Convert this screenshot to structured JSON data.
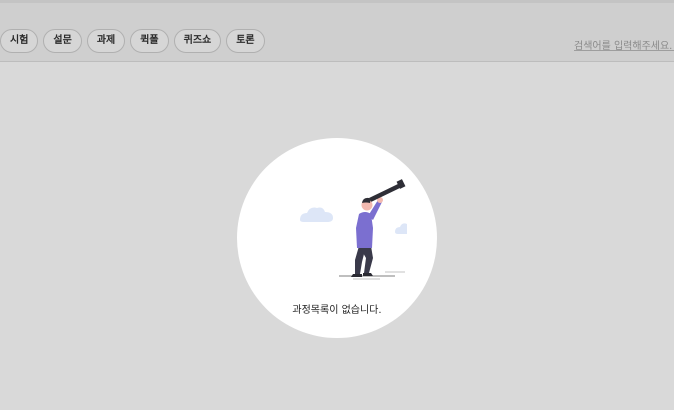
{
  "filters": [
    {
      "label": "시험"
    },
    {
      "label": "설문"
    },
    {
      "label": "과제"
    },
    {
      "label": "퀵폴"
    },
    {
      "label": "퀴즈쇼"
    },
    {
      "label": "토론"
    }
  ],
  "search": {
    "placeholder": "검색어를 입력해주세요."
  },
  "empty_state": {
    "illustration_icon": "person-with-telescope-icon",
    "message": "과정목록이 없습니다."
  },
  "colors": {
    "header_bg": "#cfcfcf",
    "page_bg": "#d9d9d9",
    "shirt": "#7b6fd0",
    "pants": "#3a3a4a",
    "cloud": "#dde6f7"
  }
}
